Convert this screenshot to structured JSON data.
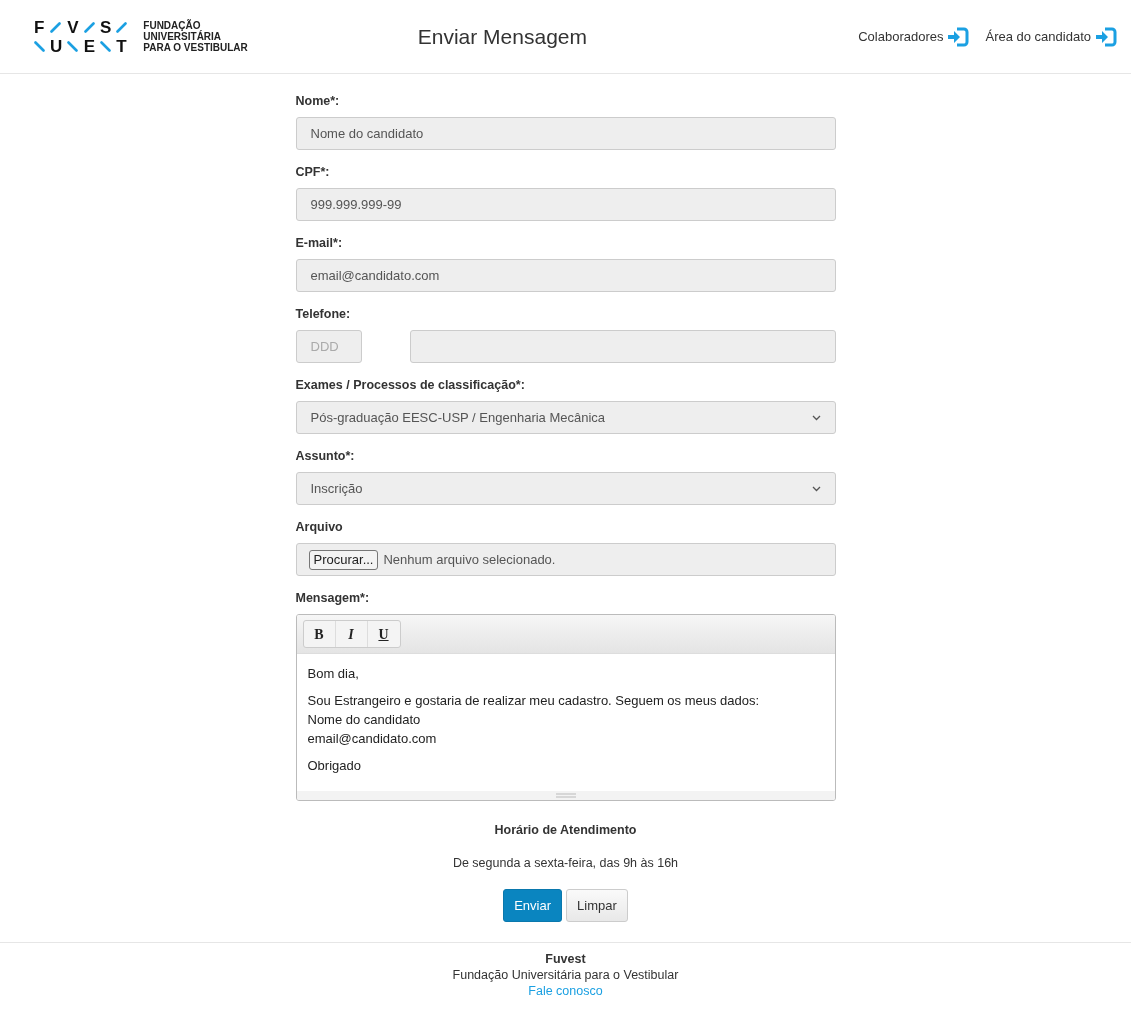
{
  "header": {
    "logo": {
      "top_letters": [
        "F",
        "V",
        "S"
      ],
      "bottom_letters": [
        "U",
        "E",
        "T"
      ],
      "text_lines": [
        "FUNDAÇÃO",
        "UNIVERSITÁRIA",
        "PARA O VESTIBULAR"
      ]
    },
    "title": "Enviar Mensagem",
    "links": [
      {
        "label": "Colaboradores"
      },
      {
        "label": "Área do candidato"
      }
    ]
  },
  "form": {
    "fields": [
      {
        "kind": "text",
        "label": "Nome*:",
        "value": "Nome do candidato"
      },
      {
        "kind": "text",
        "label": "CPF*:",
        "value": "999.999.999-99"
      },
      {
        "kind": "text",
        "label": "E-mail*:",
        "value": "email@candidato.com"
      },
      {
        "kind": "phone",
        "label": "Telefone:",
        "placeholder": "DDD"
      },
      {
        "kind": "select",
        "label": "Exames / Processos de classificação*:",
        "value": "Pós-graduação EESC-USP / Engenharia Mecânica"
      },
      {
        "kind": "select",
        "label": "Assunto*:",
        "value": "Inscrição"
      },
      {
        "kind": "file",
        "label": "Arquivo",
        "button": "Procurar...",
        "status": "Nenhum arquivo selecionado."
      },
      {
        "kind": "editor",
        "label": "Mensagem*:",
        "toolbar": [
          "B",
          "I",
          "U"
        ],
        "paragraphs": [
          [
            "Bom dia,"
          ],
          [
            "Sou Estrangeiro e gostaria de realizar meu cadastro. Seguem os meus dados:",
            "Nome do candidato",
            "email@candidato.com"
          ],
          [
            "Obrigado"
          ]
        ]
      }
    ],
    "hours_title": "Horário de Atendimento",
    "hours_text": "De segunda a sexta-feira, das 9h às 16h",
    "buttons": [
      {
        "label": "Enviar",
        "primary": true
      },
      {
        "label": "Limpar",
        "primary": false
      }
    ]
  },
  "footer": {
    "title": "Fuvest",
    "subtitle": "Fundação Universitária para o Vestibular",
    "link": "Fale conosco"
  }
}
